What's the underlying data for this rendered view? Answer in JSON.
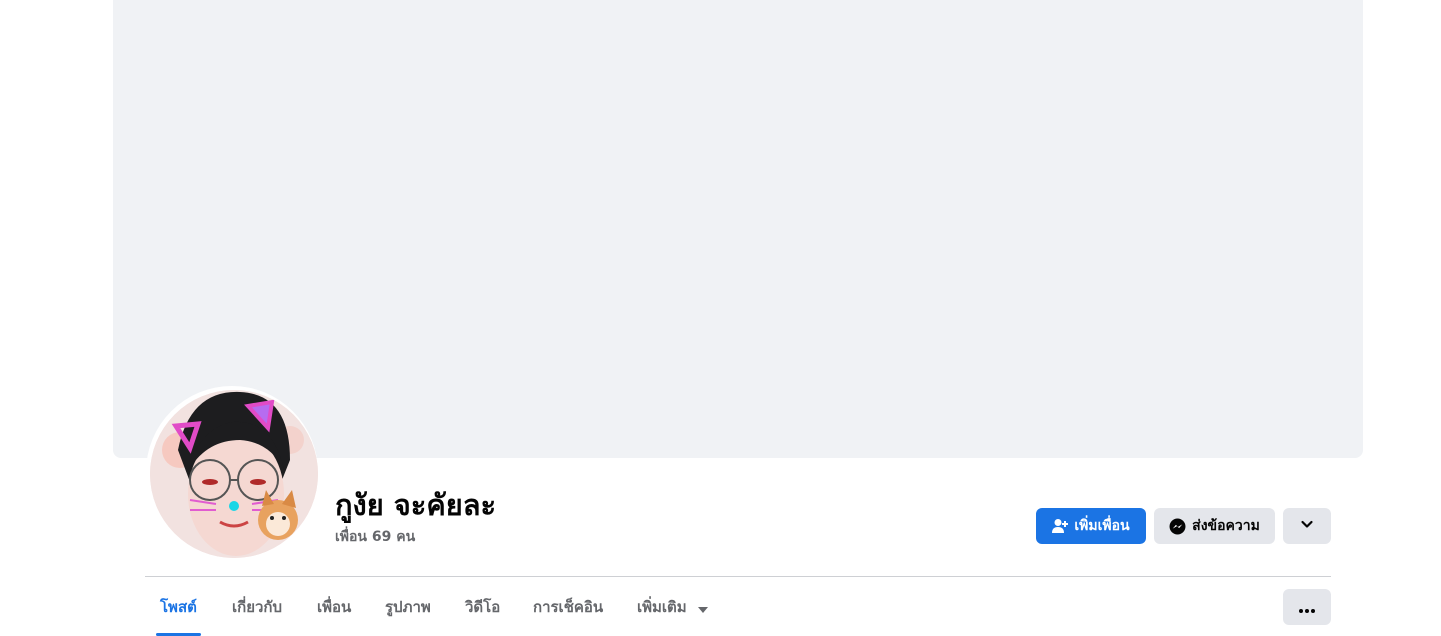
{
  "profile": {
    "name": "กูงัย จะคัยละ",
    "friends_count": "เพื่อน 69 คน"
  },
  "actions": {
    "add_friend_label": "เพิ่มเพื่อน",
    "message_label": "ส่งข้อความ"
  },
  "tabs": [
    {
      "label": "โพสต์",
      "active": true
    },
    {
      "label": "เกี่ยวกับ",
      "active": false
    },
    {
      "label": "เพื่อน",
      "active": false
    },
    {
      "label": "รูปภาพ",
      "active": false
    },
    {
      "label": "วิดีโอ",
      "active": false
    },
    {
      "label": "การเช็คอิน",
      "active": false
    },
    {
      "label": "เพิ่มเติม",
      "active": false
    }
  ],
  "icons": {
    "add_friend": "user-plus-icon",
    "message": "messenger-icon",
    "dropdown": "chevron-down-icon",
    "tab_more": "caret-down-icon",
    "overflow": "ellipsis-icon"
  },
  "colors": {
    "accent": "#1b74e4",
    "cover": "#f0f2f5",
    "secondary_button": "#e4e6eb",
    "muted_text": "#65676b"
  }
}
